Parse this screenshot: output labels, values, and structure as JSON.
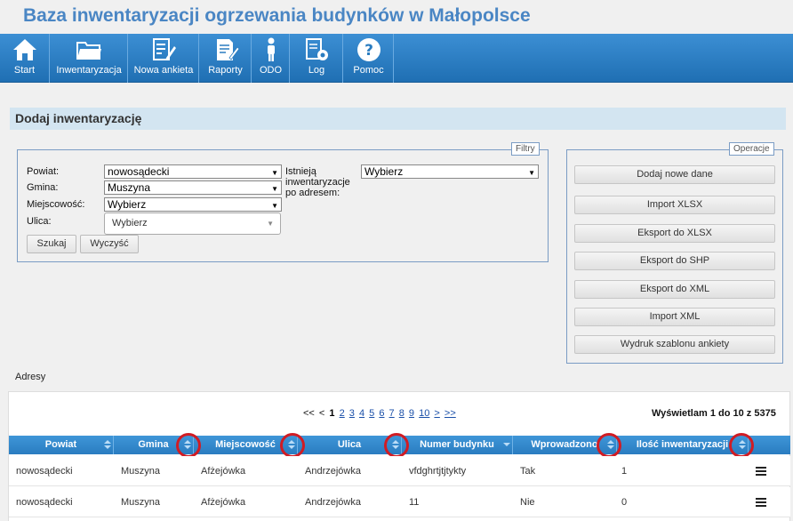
{
  "app": {
    "title": "Baza inwentaryzacji ogrzewania budynków w Małopolsce"
  },
  "nav": [
    {
      "label": "Start",
      "icon": "home-icon"
    },
    {
      "label": "Inwentaryzacja",
      "icon": "folder-icon"
    },
    {
      "label": "Nowa ankieta",
      "icon": "form-edit-icon"
    },
    {
      "label": "Raporty",
      "icon": "report-edit-icon"
    },
    {
      "label": "ODO",
      "icon": "person-icon"
    },
    {
      "label": "Log",
      "icon": "log-settings-icon"
    },
    {
      "label": "Pomoc",
      "icon": "help-icon"
    }
  ],
  "section": {
    "title": "Dodaj inwentaryzację"
  },
  "filters": {
    "legend": "Filtry",
    "powiat_label": "Powiat:",
    "powiat_value": "nowosądecki",
    "gmina_label": "Gmina:",
    "gmina_value": "Muszyna",
    "miejscowosc_label": "Miejscowość:",
    "miejscowosc_value": "Wybierz",
    "ulica_label": "Ulica:",
    "ulica_value": "Wybierz",
    "istnieja_label_1": "Istnieją",
    "istnieja_label_2": "inwentaryzacje",
    "istnieja_label_3": "po adresem:",
    "istnieja_value": "Wybierz",
    "search_button": "Szukaj",
    "clear_button": "Wyczyść"
  },
  "operations": {
    "legend": "Operacje",
    "buttons": [
      "Dodaj nowe dane",
      "Import XLSX",
      "Eksport do XLSX",
      "Eksport do SHP",
      "Eksport do XML",
      "Import XML",
      "Wydruk szablonu ankiety"
    ]
  },
  "grid": {
    "caption": "Adresy",
    "pager": {
      "first": "<<",
      "prev": "<",
      "current": "1",
      "pages": [
        "2",
        "3",
        "4",
        "5",
        "6",
        "7",
        "8",
        "9",
        "10"
      ],
      "next": ">",
      "last": ">>"
    },
    "record_info": "Wyświetlam 1 do 10 z 5375",
    "columns": [
      "Powiat",
      "Gmina",
      "Miejscowość",
      "Ulica",
      "Numer budynku",
      "Wprowadzono",
      "Ilość inwentaryzacji"
    ],
    "rows": [
      {
        "powiat": "nowosądecki",
        "gmina": "Muszyna",
        "miejscowosc": "Afżejówka",
        "ulica": "Andrzejówka",
        "numer": "vfdghrtjtjtykty",
        "wprowadzono": "Tak",
        "ilosc": "1"
      },
      {
        "powiat": "nowosądecki",
        "gmina": "Muszyna",
        "miejscowosc": "Afżejówka",
        "ulica": "Andrzejówka",
        "numer": "11",
        "wprowadzono": "Nie",
        "ilosc": "0"
      }
    ]
  },
  "colors": {
    "nav_top": "#3c8fd4",
    "nav_bottom": "#1f6fb3",
    "title": "#4a86c4",
    "annotation": "#d01c24"
  }
}
